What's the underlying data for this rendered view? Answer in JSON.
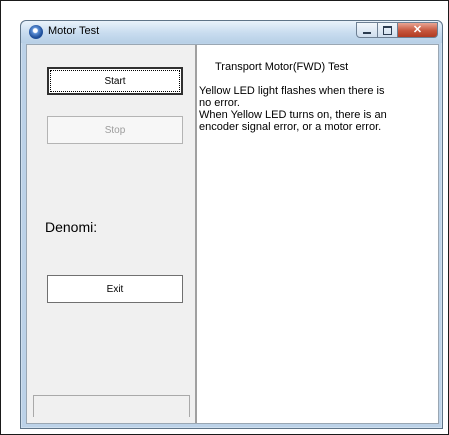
{
  "window": {
    "title": "Motor Test",
    "icon": "motor-test-app-icon",
    "caption_buttons": [
      "minimize",
      "maximize",
      "close"
    ],
    "close_glyph": "✕"
  },
  "left_panel": {
    "start_label": "Start",
    "stop_label": "Stop",
    "denomi_label": "Denomi:",
    "exit_label": "Exit"
  },
  "right_panel": {
    "title": "Transport Motor(FWD) Test",
    "line1": " Yellow LED light flashes when there is",
    "line2": "no error.",
    "line3": " When Yellow LED turns on, there is an",
    "line4": "encoder signal error, or a motor error."
  },
  "colors": {
    "titlebar": "#c8dcef",
    "close_button": "#c6553c",
    "client_background": "#f0f0f0",
    "disabled_text": "#9d9d9d"
  }
}
